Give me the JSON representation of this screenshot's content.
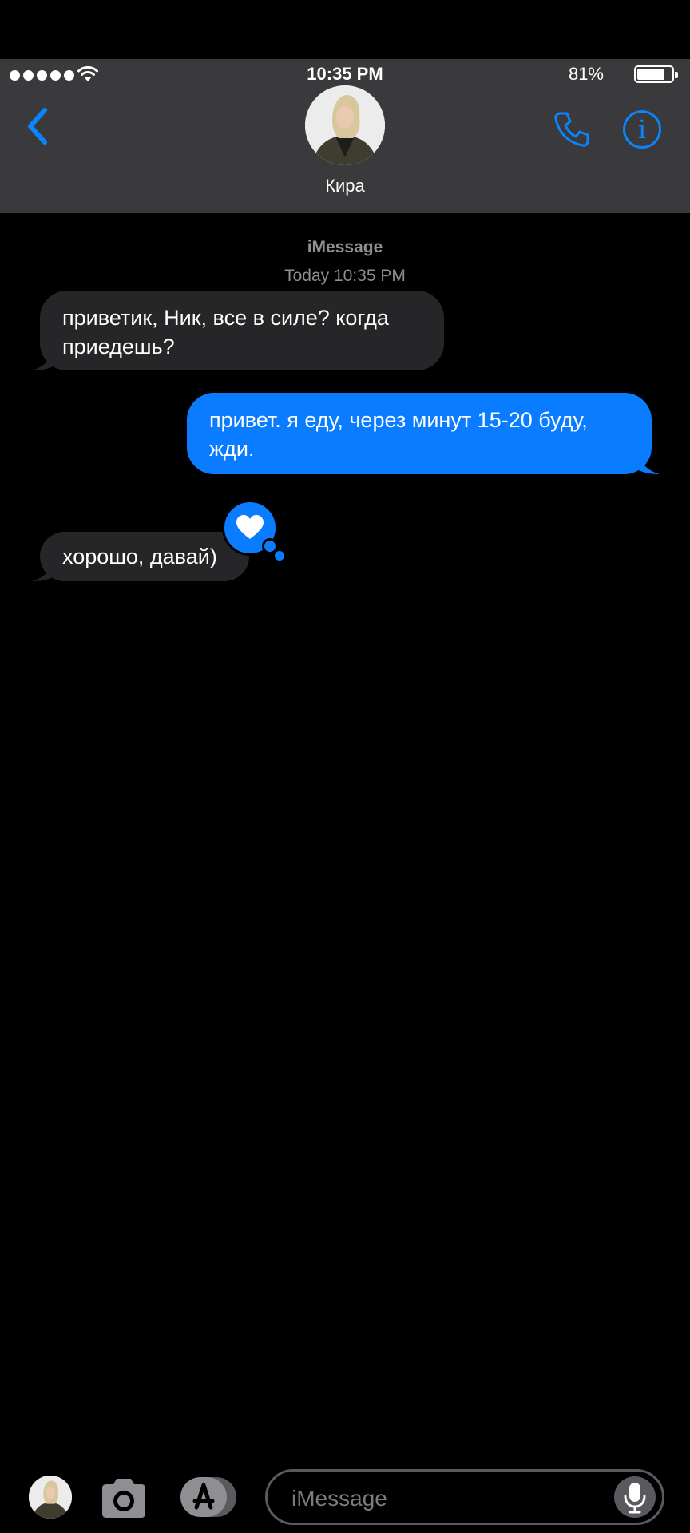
{
  "status_bar": {
    "time": "10:35 PM",
    "battery_percent": "81%",
    "battery_level": 0.81,
    "signal_bars": 5,
    "wifi_icon": "wifi-icon"
  },
  "header": {
    "contact_name": "Кира",
    "back_icon": "chevron-left-icon",
    "phone_icon": "phone-icon",
    "info_icon": "info-icon",
    "info_glyph": "i"
  },
  "conversation": {
    "service": "iMessage",
    "timestamp": "Today 10:35 PM",
    "messages": [
      {
        "direction": "incoming",
        "text": "приветик, Ник, все в силе? когда приедешь?"
      },
      {
        "direction": "outgoing",
        "text": "привет. я еду, через минут 15-20 буду, жди."
      },
      {
        "direction": "incoming",
        "text": "хорошо, давай)",
        "reaction": "heart-icon"
      }
    ]
  },
  "compose": {
    "placeholder": "iMessage",
    "camera_icon": "camera-icon",
    "apps_icon": "app-store-icon",
    "mic_icon": "microphone-icon"
  },
  "colors": {
    "accent": "#0a84ff",
    "outgoing_bubble": "#0a7cff",
    "incoming_bubble": "#262628",
    "header_bg": "#3a3a3c",
    "secondary_text": "#8e8e93"
  }
}
